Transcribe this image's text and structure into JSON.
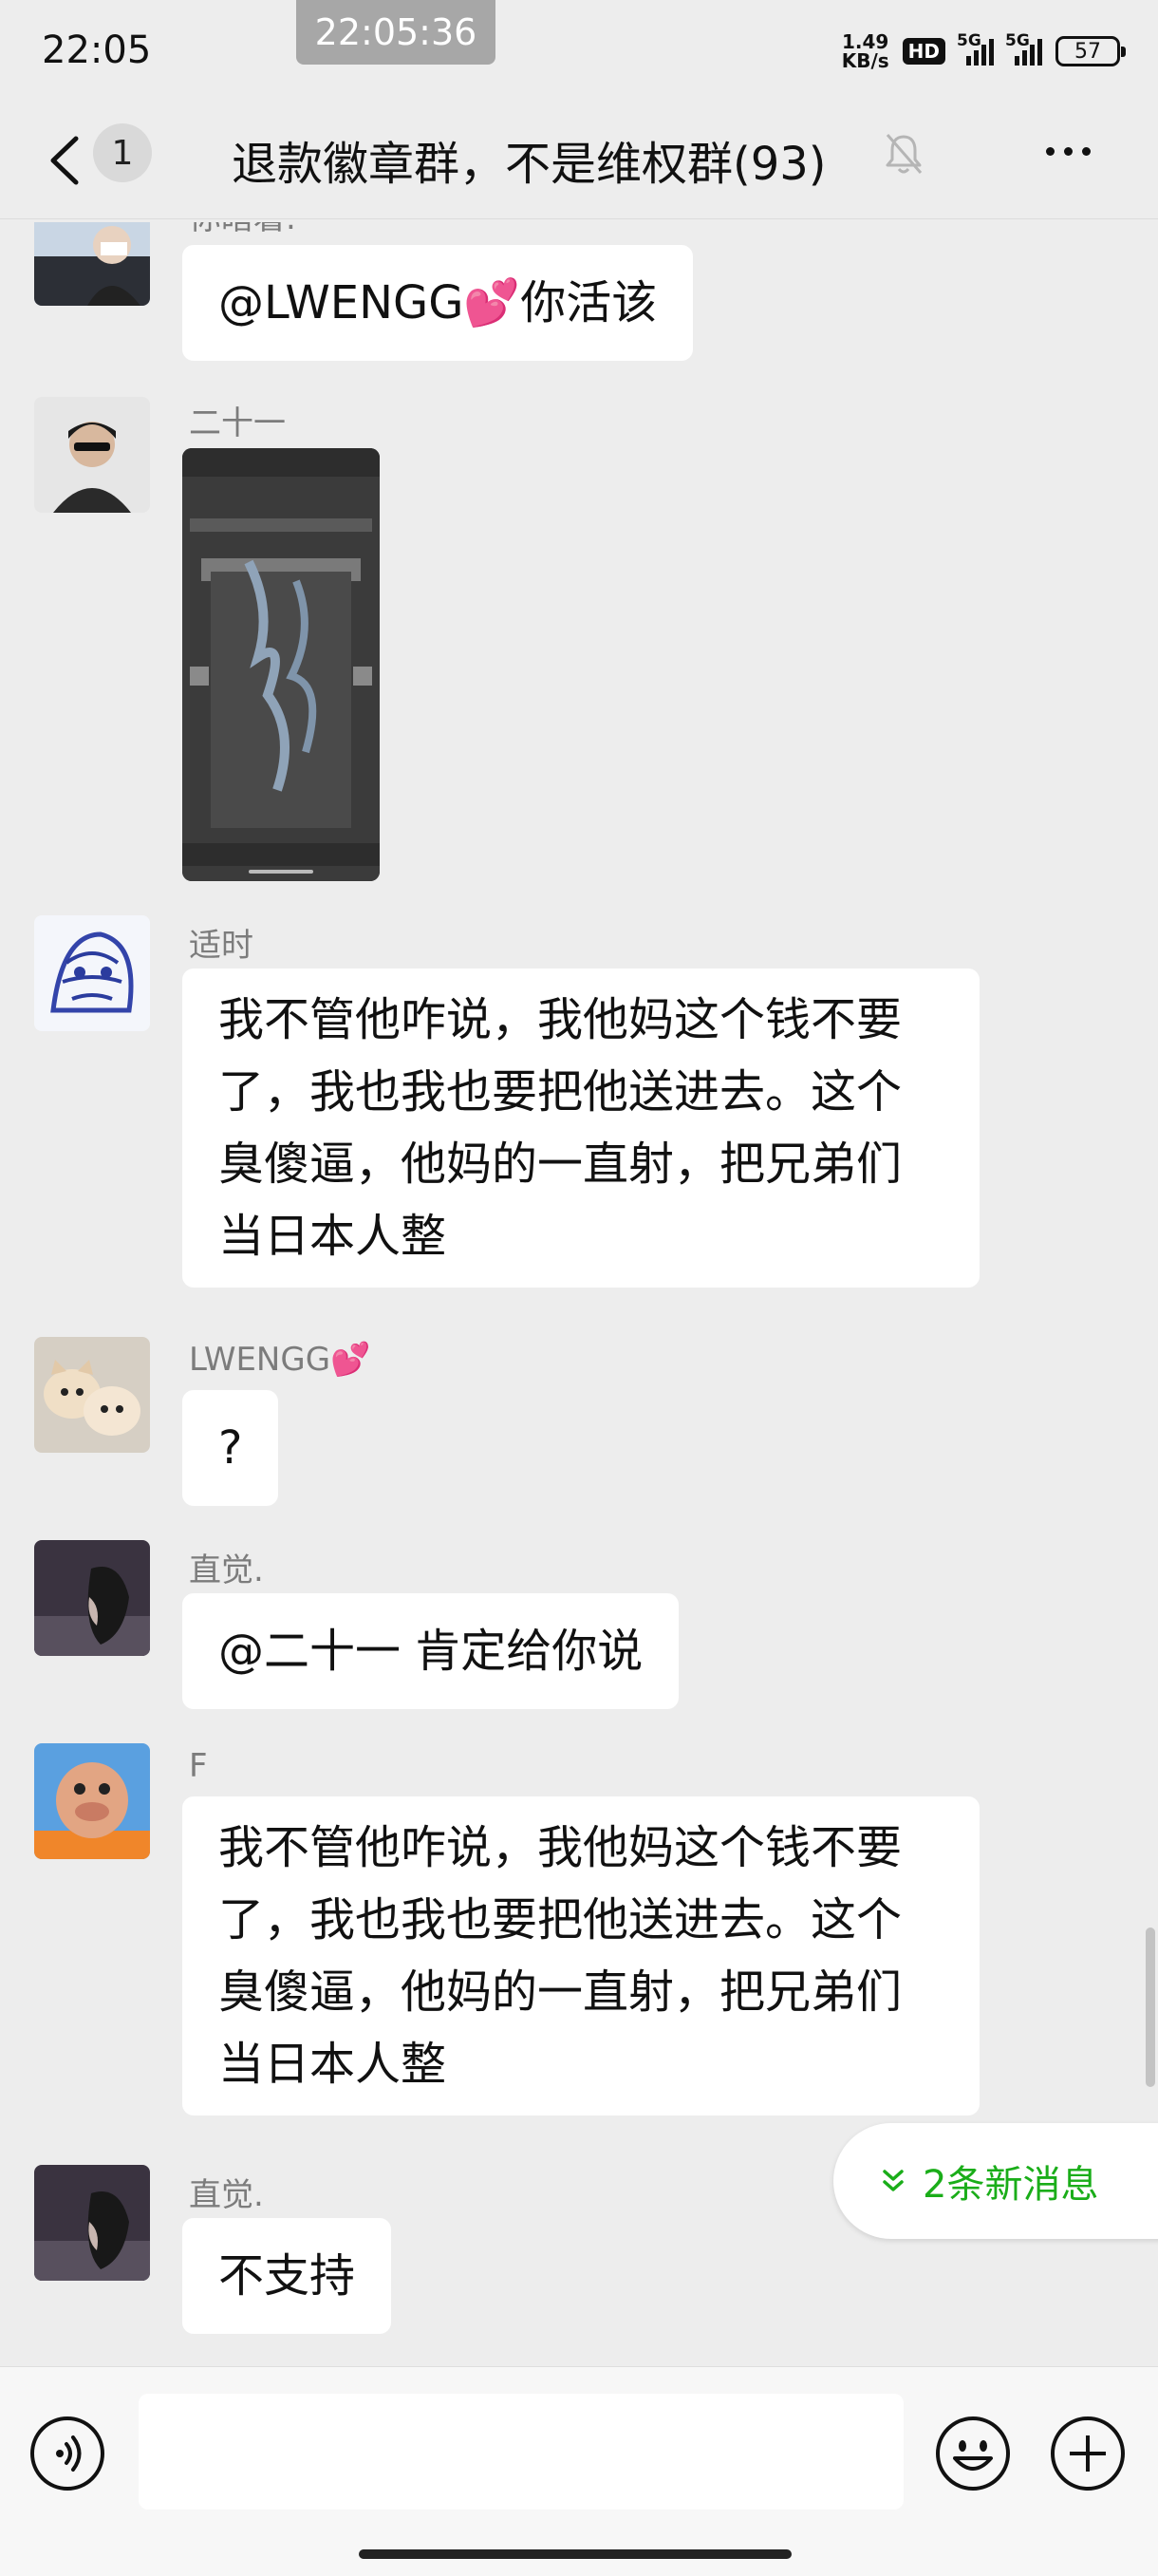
{
  "status_bar": {
    "time": "22:05",
    "recording_time": "22:05:36",
    "net_speed_value": "1.49",
    "net_speed_unit": "KB/s",
    "hd_label": "HD",
    "network_1": "5G",
    "network_2": "5G",
    "battery": "57"
  },
  "nav": {
    "unread_count": "1",
    "title": "退款徽章群，不是维权群(93)"
  },
  "messages": [
    {
      "sender": "你瞎着.",
      "text_prefix": "@LWENGG",
      "emoji": "💕",
      "text_suffix": " 你活该"
    },
    {
      "sender": "二十一",
      "type": "image"
    },
    {
      "sender": "适时",
      "text": "我不管他咋说，我他妈这个钱不要了，我也我也要把他送进去。这个臭傻逼，他妈的一直射，把兄弟们当日本人整"
    },
    {
      "sender": "LWENGG",
      "sender_emoji": "💕",
      "text": "?"
    },
    {
      "sender": "直觉.",
      "text": "@二十一  肯定给你说"
    },
    {
      "sender": "F",
      "text": "我不管他咋说，我他妈这个钱不要了，我也我也要把他送进去。这个臭傻逼，他妈的一直射，把兄弟们当日本人整"
    },
    {
      "sender": "直觉.",
      "text": "不支持"
    }
  ],
  "new_messages_label": "2条新消息",
  "colors": {
    "background": "#ededed",
    "bubble": "#ffffff",
    "accent_green": "#1aad19",
    "sender_gray": "#7c7c7c"
  },
  "icons": [
    "back-arrow-icon",
    "mute-bell-icon",
    "more-icon",
    "voice-icon",
    "emoji-icon",
    "plus-icon",
    "double-chevron-down-icon"
  ]
}
